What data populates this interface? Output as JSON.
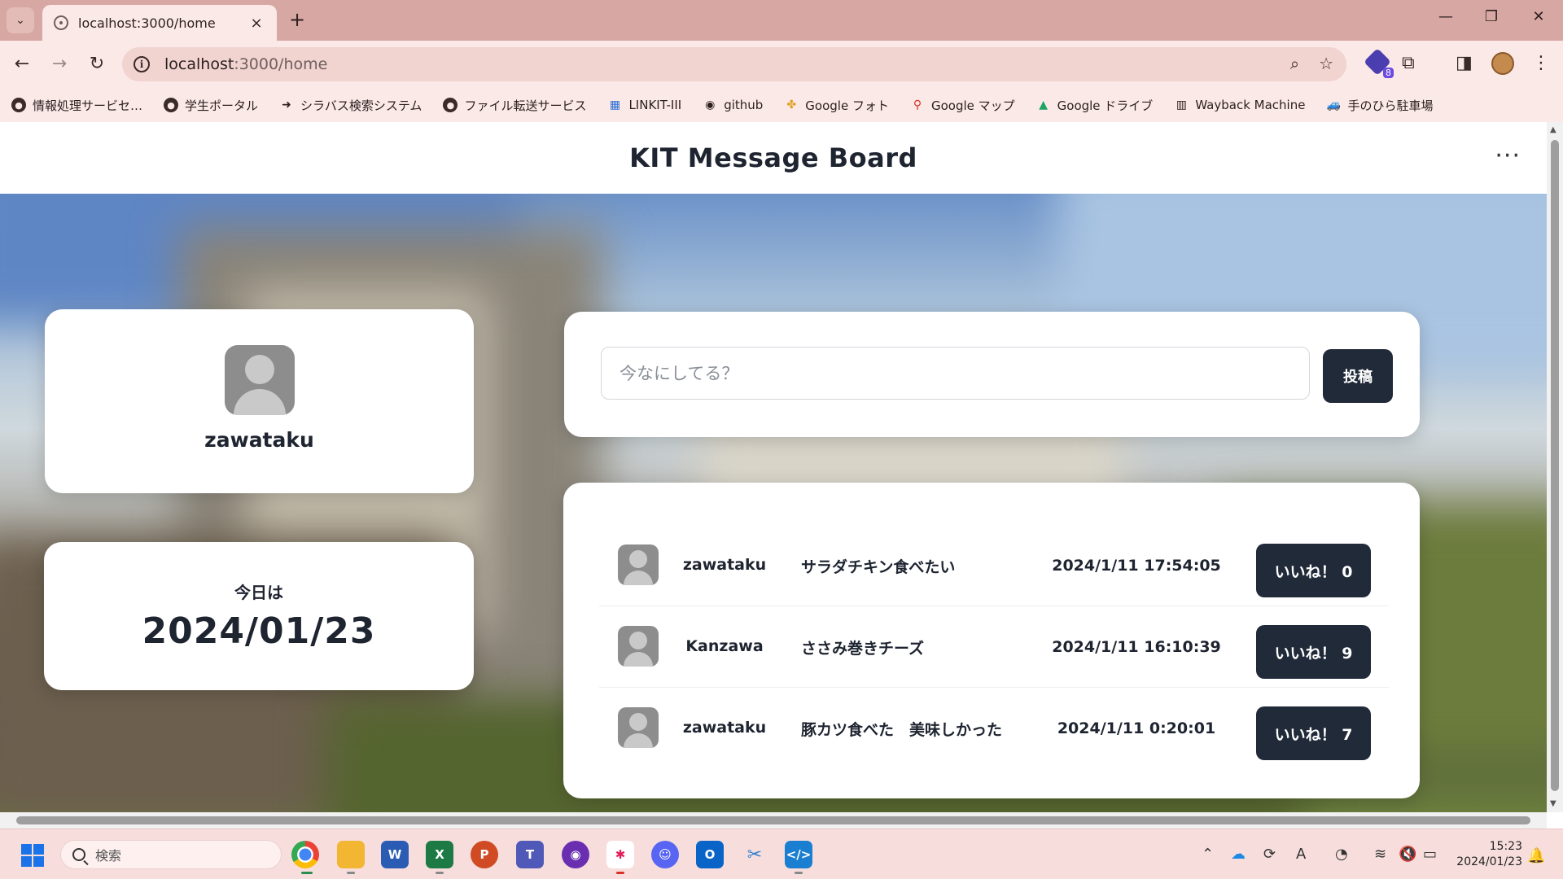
{
  "browser": {
    "tab_title": "localhost:3000/home",
    "url_host": "localhost",
    "url_path": ":3000/home",
    "extension_badge": "8"
  },
  "bookmarks": [
    {
      "label": "情報処理サービセ…",
      "icon": "globe-icon"
    },
    {
      "label": "学生ポータル",
      "icon": "globe-icon"
    },
    {
      "label": "シラバス検索システム",
      "icon": "arrow-icon"
    },
    {
      "label": "ファイル転送サービス",
      "icon": "globe-icon"
    },
    {
      "label": "LINKIT-III",
      "icon": "linkit-icon"
    },
    {
      "label": "github",
      "icon": "github-icon"
    },
    {
      "label": "Google フォト",
      "icon": "google-photos-icon"
    },
    {
      "label": "Google マップ",
      "icon": "google-maps-icon"
    },
    {
      "label": "Google ドライブ",
      "icon": "google-drive-icon"
    },
    {
      "label": "Wayback Machine",
      "icon": "wayback-icon"
    },
    {
      "label": "手のひら駐車場",
      "icon": "parking-icon"
    }
  ],
  "app": {
    "title": "KIT Message Board",
    "more_label": "···"
  },
  "profile": {
    "username": "zawataku"
  },
  "today": {
    "label": "今日は",
    "date": "2024/01/23"
  },
  "composer": {
    "placeholder": "今なにしてる？",
    "submit_label": "投稿"
  },
  "posts": [
    {
      "user": "zawataku",
      "message": "サラダチキン食べたい",
      "time": "2024/1/11 17:54:05",
      "like_label": "いいね！ 0"
    },
    {
      "user": "Kanzawa",
      "message": "ささみ巻きチーズ",
      "time": "2024/1/11 16:10:39",
      "like_label": "いいね！ 9"
    },
    {
      "user": "zawataku",
      "message": "豚カツ食べた　美味しかった",
      "time": "2024/1/11 0:20:01",
      "like_label": "いいね！ 7"
    }
  ],
  "taskbar": {
    "search_placeholder": "検索",
    "time": "15:23",
    "date": "2024/01/23"
  },
  "colors": {
    "tabstrip": "#d7a7a3",
    "toolbar": "#fbe9e8",
    "button_dark": "#202a38",
    "card": "#ffffff"
  }
}
